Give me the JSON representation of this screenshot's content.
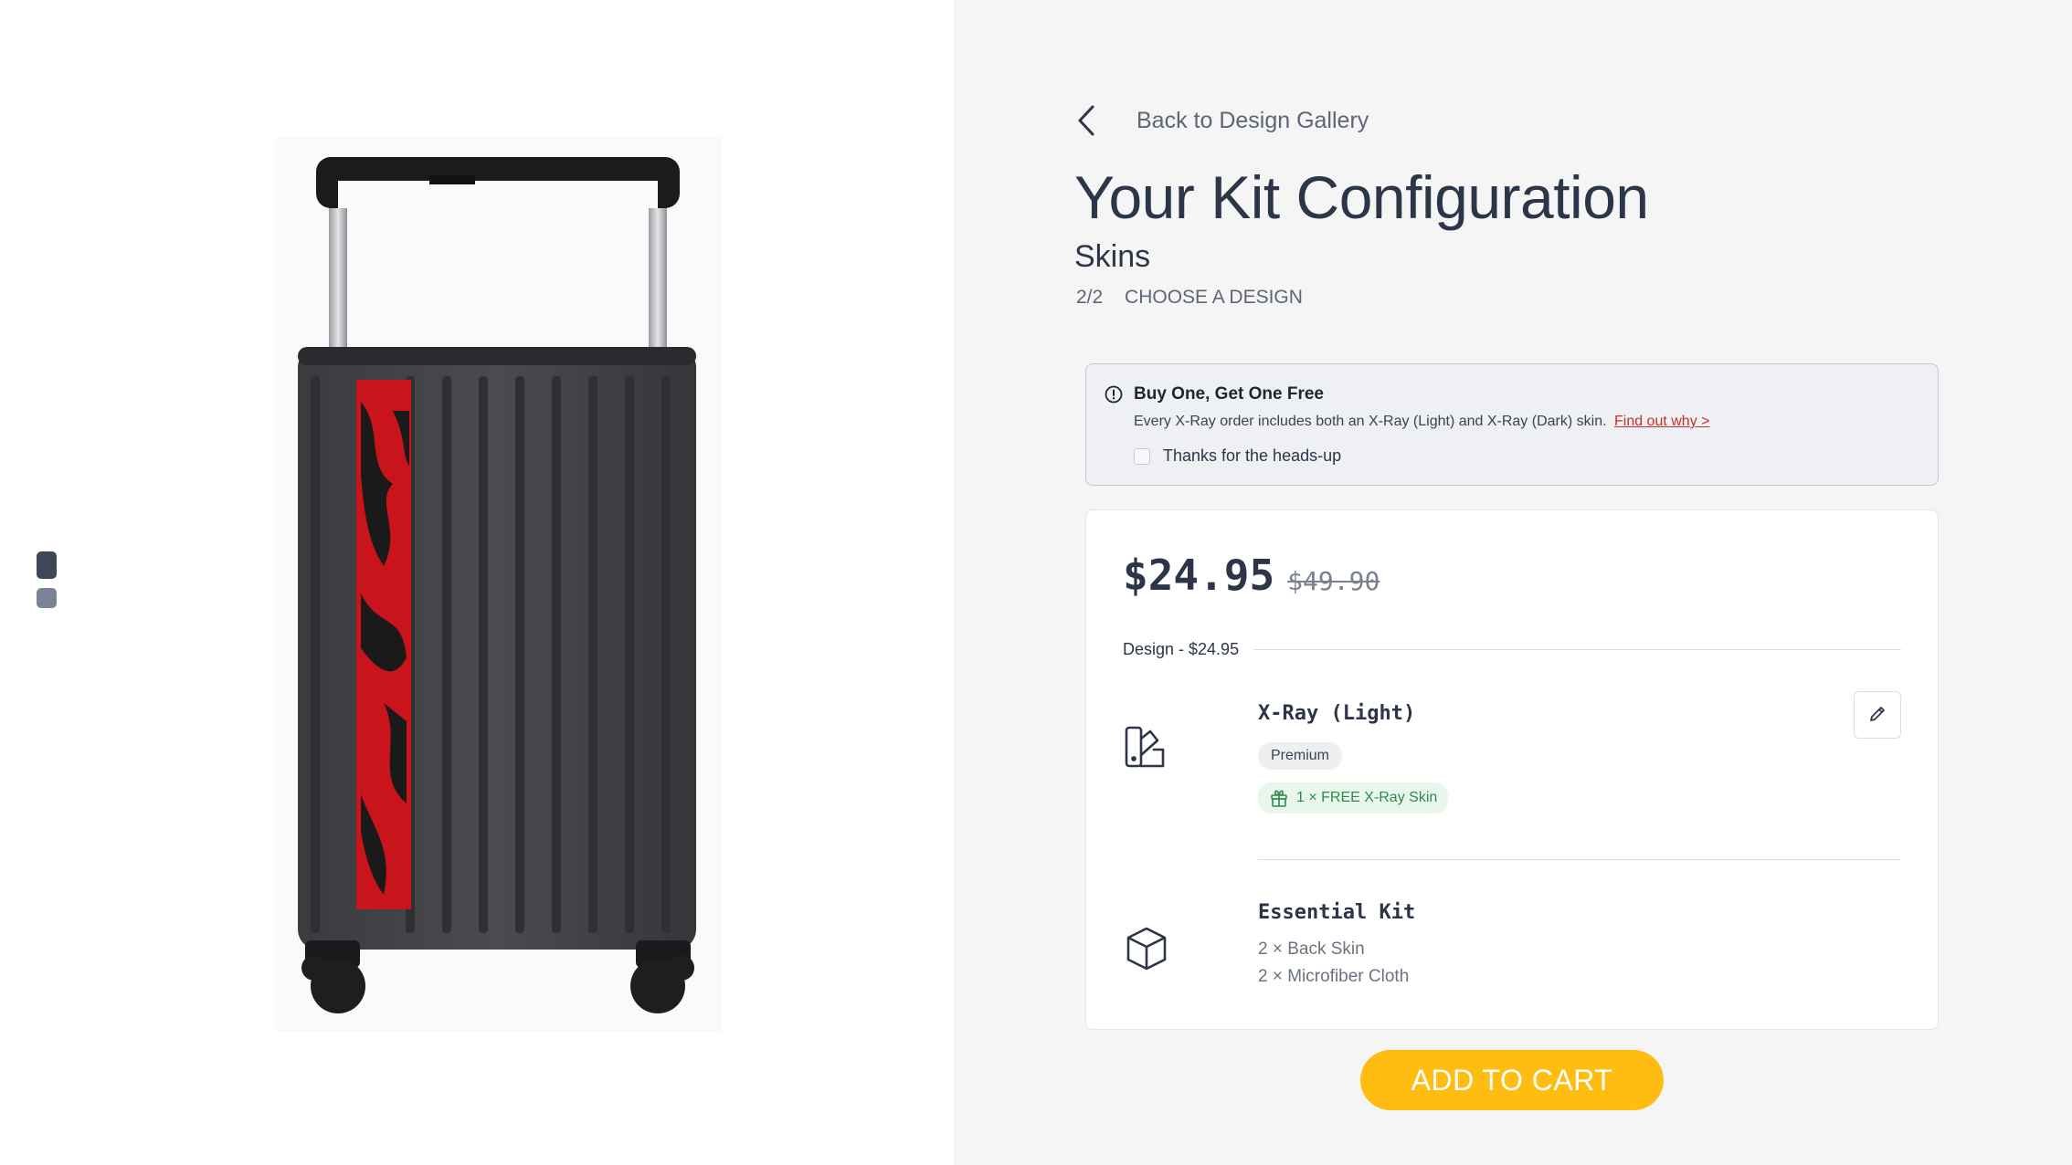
{
  "gallery": {
    "thumbnails": [
      "thumb-1",
      "thumb-2"
    ],
    "product_icon": "suitcase-with-red-skin"
  },
  "nav": {
    "back_label": "Back to Design Gallery",
    "back_icon": "chevron-left-icon"
  },
  "header": {
    "title": "Your Kit Configuration",
    "subtitle": "Skins",
    "step_number": "2/2",
    "step_label": "CHOOSE A DESIGN"
  },
  "notice": {
    "icon": "info-circle-icon",
    "heading": "Buy One, Get One Free",
    "body": "Every X-Ray order includes both an X-Ray (Light) and X-Ray (Dark) skin.",
    "link": "Find out why >",
    "checkbox_label": "Thanks for the heads-up",
    "checked": false
  },
  "summary": {
    "price": "$24.95",
    "original_price": "$49.90",
    "section_label": "Design - $24.95",
    "design": {
      "icon": "swatch-book-icon",
      "name": "X-Ray (Light)",
      "tier": "Premium",
      "bonus": "1 × FREE X-Ray Skin",
      "bonus_icon": "gift-icon",
      "edit_icon": "pencil-icon"
    },
    "kit": {
      "icon": "box-icon",
      "name": "Essential Kit",
      "items": [
        "2 × Back Skin",
        "2 × Microfiber Cloth"
      ]
    }
  },
  "cta": {
    "label": "ADD TO CART"
  },
  "colors": {
    "accent": "#ffbd12",
    "link": "#c7312b",
    "success_text": "#2f8a4a",
    "success_bg": "#e8f6ec",
    "text_primary": "#2c3648"
  }
}
